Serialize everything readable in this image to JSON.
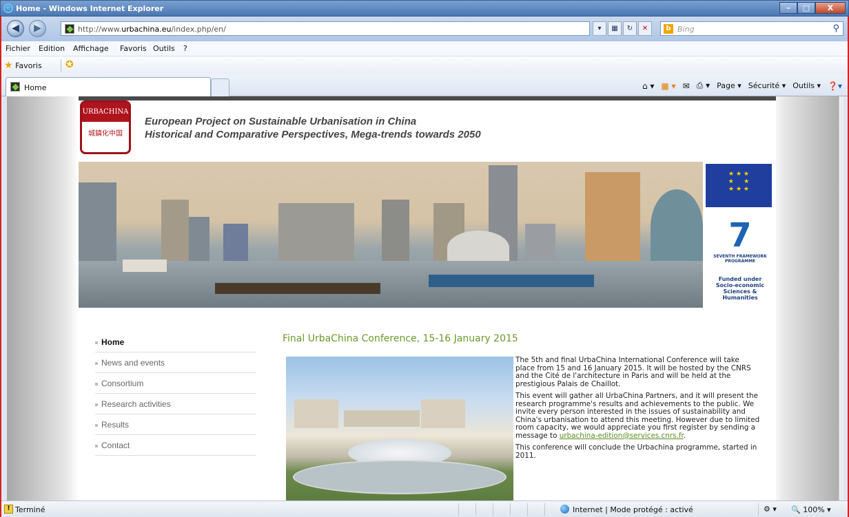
{
  "window": {
    "title": "Home - Windows Internet Explorer",
    "buttons": [
      "–",
      "□",
      "X"
    ]
  },
  "address": {
    "url_prefix": "http://www.",
    "url_domain": "urbachina.eu",
    "url_path": "/index.php/en/"
  },
  "search": {
    "placeholder": "Bing"
  },
  "menu": {
    "items": [
      "Fichier",
      "Edition",
      "Affichage",
      "Favoris",
      "Outils",
      "?"
    ]
  },
  "favorites": {
    "label": "Favoris"
  },
  "tab": {
    "label": "Home"
  },
  "commandbar": {
    "page": "Page ▾",
    "security": "Sécurité ▾",
    "tools": "Outils ▾"
  },
  "site": {
    "logo_top": "URBACHINA",
    "logo_chinese": "城鎮化中国",
    "tagline1": "European Project on Sustainable Urbanisation in China",
    "tagline2": "Historical and Comparative Perspectives, Mega-trends towards 2050",
    "fp7_small1": "SEVENTH FRAMEWORK",
    "fp7_small2": "PROGRAMME",
    "fp7_funded1": "Funded under",
    "fp7_funded2": "Socio-economic",
    "fp7_funded3": "Sciences & Humanities"
  },
  "nav": {
    "items": [
      "Home",
      "News and events",
      "Consortium",
      "Research activities",
      "Results",
      "Contact"
    ],
    "active": "Home"
  },
  "article": {
    "title": "Final UrbaChina Conference, 15-16 January 2015",
    "p1": "The 5th and final UrbaChina International Conference will take place from 15 and 16 January 2015. It will be hosted by the CNRS and the Cité de l'architecture in Paris and will be held at the prestigious Palais de Chaillot.",
    "p2_before": "This event will gather all UrbaChina Partners, and it will present the research programme's results and achievements to the public. We invite every person interested in the issues of sustainability and China's urbanisation to attend this meeting. However due to limited room capacity, we would appreciate you first register by sending a message to ",
    "p2_link": "urbachina-edition@services.cnrs.fr",
    "p2_after": ".",
    "p3": "This conference will conclude the Urbachina programme, started in 2011."
  },
  "status": {
    "left": "Terminé",
    "zone": "Internet | Mode protégé : activé",
    "zoom": "100%"
  }
}
